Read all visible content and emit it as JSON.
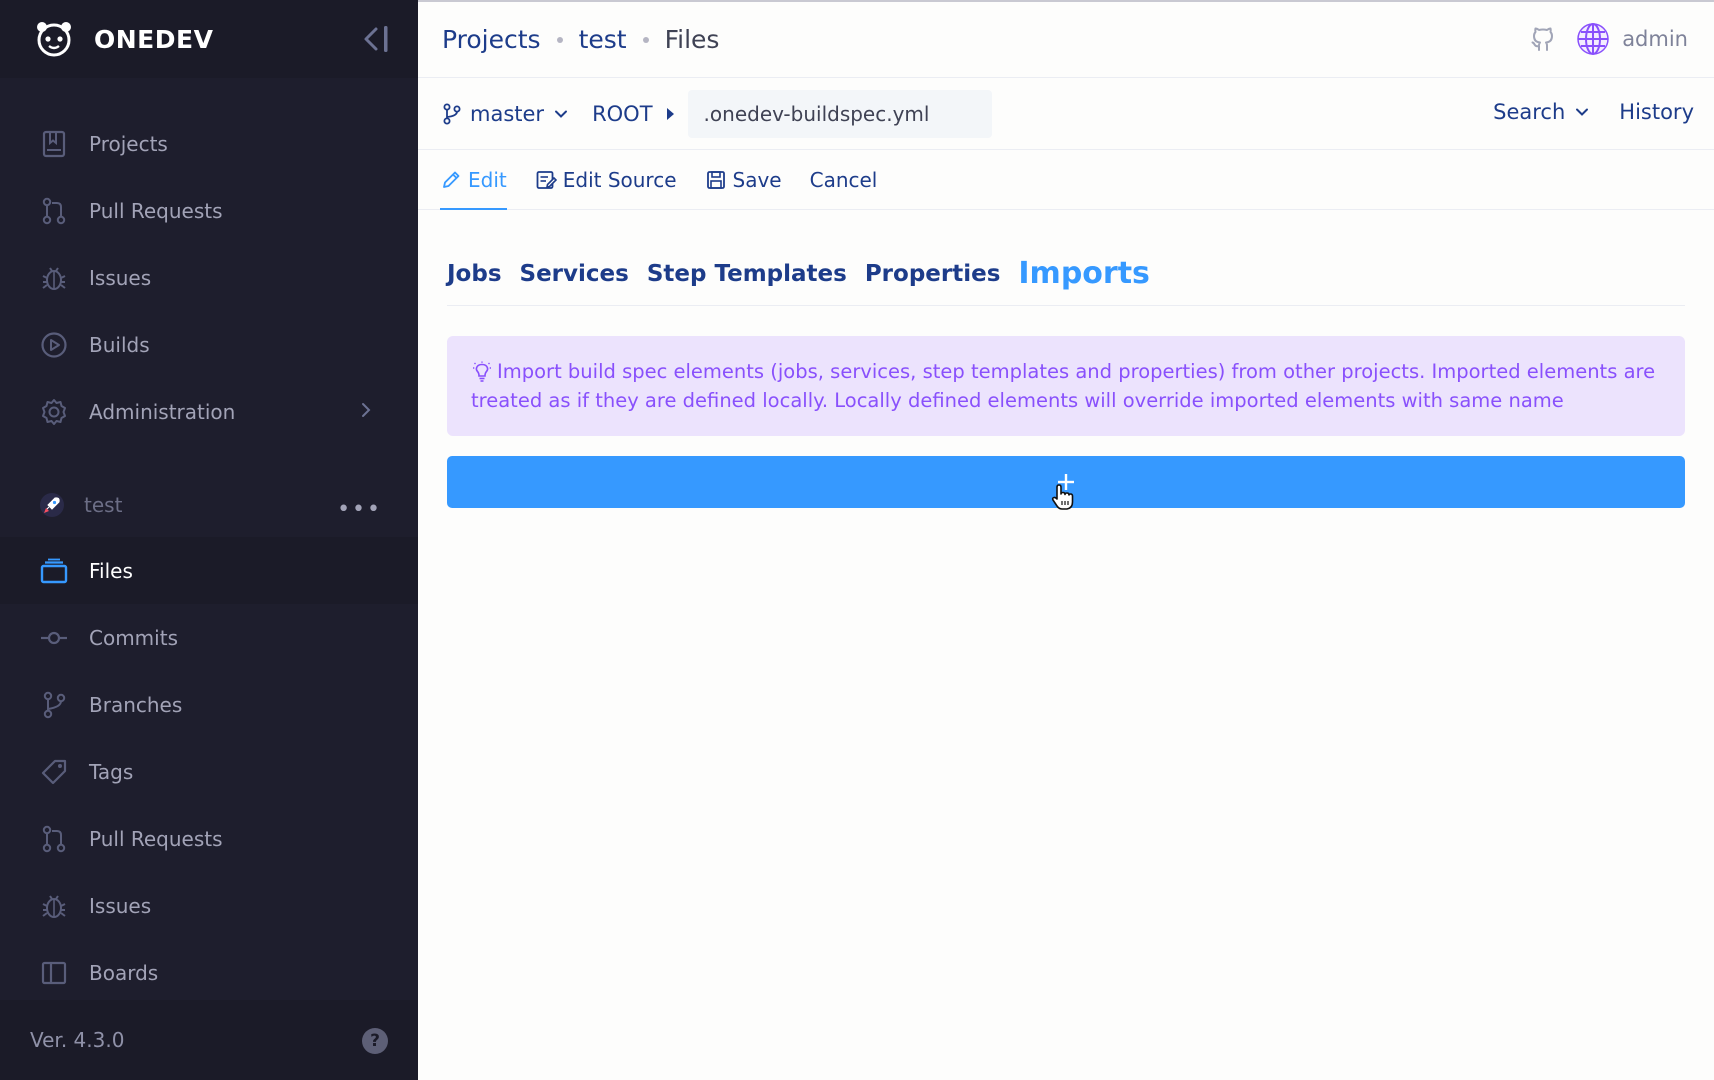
{
  "brand": {
    "name": "ONEDEV"
  },
  "sidebar": {
    "global_items": [
      {
        "label": "Projects",
        "icon": "bookmark-icon"
      },
      {
        "label": "Pull Requests",
        "icon": "pull-request-icon"
      },
      {
        "label": "Issues",
        "icon": "bug-icon"
      },
      {
        "label": "Builds",
        "icon": "play-circle-icon"
      },
      {
        "label": "Administration",
        "icon": "gear-icon"
      }
    ],
    "project": {
      "name": "test",
      "more": "•••"
    },
    "project_items": [
      {
        "label": "Files",
        "icon": "folder-icon",
        "active": true
      },
      {
        "label": "Commits",
        "icon": "commit-icon"
      },
      {
        "label": "Branches",
        "icon": "branch-icon"
      },
      {
        "label": "Tags",
        "icon": "tag-icon"
      },
      {
        "label": "Pull Requests",
        "icon": "pull-request-icon"
      },
      {
        "label": "Issues",
        "icon": "bug-icon"
      },
      {
        "label": "Boards",
        "icon": "board-icon"
      }
    ],
    "version": "Ver. 4.3.0",
    "help": "?"
  },
  "header": {
    "breadcrumbs": [
      "Projects",
      "test",
      "Files"
    ],
    "user": "admin"
  },
  "filebar": {
    "branch": "master",
    "root": "ROOT",
    "filename": ".onedev-buildspec.yml",
    "search": "Search",
    "history": "History"
  },
  "actions": {
    "edit": "Edit",
    "edit_source": "Edit Source",
    "save": "Save",
    "cancel": "Cancel"
  },
  "tabs": [
    "Jobs",
    "Services",
    "Step Templates",
    "Properties",
    "Imports"
  ],
  "active_tab": "Imports",
  "alert": {
    "text": "Import build spec elements (jobs, services, step templates and properties) from other projects. Imported elements are treated as if they are defined locally. Locally defined elements will override imported elements with same name"
  },
  "add_button": {
    "icon": "plus-icon"
  },
  "colors": {
    "sidebar_bg": "#1e1e2d",
    "accent": "#3699ff",
    "link": "#1d3c8a",
    "alert_bg": "#ece3fd",
    "alert_text": "#8950fc"
  }
}
